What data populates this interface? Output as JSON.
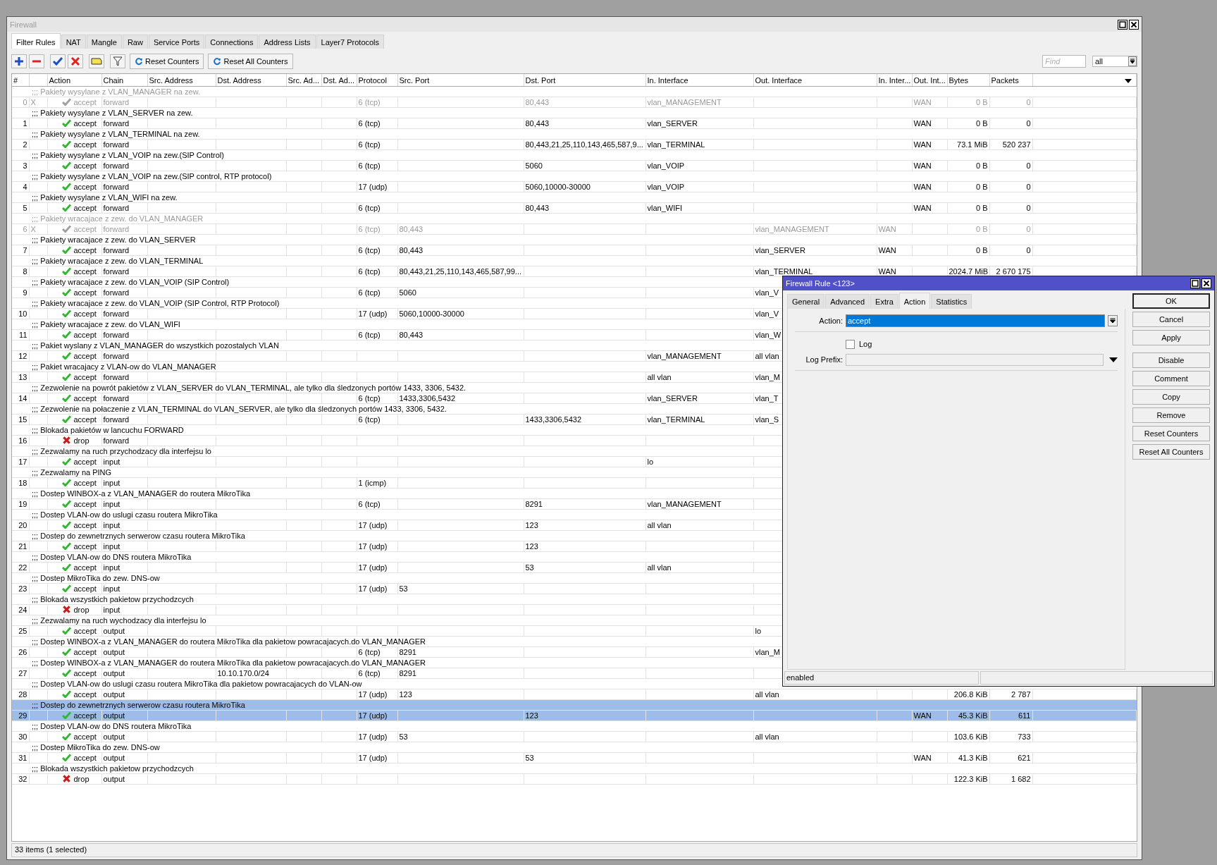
{
  "window": {
    "title": "Firewall"
  },
  "tabs": [
    {
      "label": "Filter Rules",
      "selected": true
    },
    {
      "label": "NAT",
      "selected": false
    },
    {
      "label": "Mangle",
      "selected": false
    },
    {
      "label": "Raw",
      "selected": false
    },
    {
      "label": "Service Ports",
      "selected": false
    },
    {
      "label": "Connections",
      "selected": false
    },
    {
      "label": "Address Lists",
      "selected": false
    },
    {
      "label": "Layer7 Protocols",
      "selected": false
    }
  ],
  "toolbar": {
    "buttons": [
      "Reset Counters",
      "Reset All Counters"
    ],
    "search": {
      "placeholder": "Find"
    },
    "filter": "all"
  },
  "table": {
    "columns": [
      "#",
      "",
      "Action",
      "Chain",
      "Src. Address",
      "Dst. Address",
      "Src. Ad...",
      "Dst. Ad...",
      "Protocol",
      "Src. Port",
      "Dst. Port",
      "In. Interface",
      "Out. Interface",
      "In. Inter...",
      "Out. Int...",
      "Bytes",
      "Packets"
    ],
    "rules": [
      {
        "comment": ";;; Pakiety wysylane z VLAN_MANAGER na zew.",
        "num": "0",
        "flag": "X",
        "kind": "accept",
        "action": "accept",
        "chain": "forward",
        "protocol": "6 (tcp)",
        "dst_port": "80,443",
        "in_interface": "vlan_MANAGEMENT",
        "out_interface_list": "WAN",
        "bytes": "0 B",
        "packets": "0",
        "disabled": true,
        "selected": false
      },
      {
        "comment": ";;; Pakiety wysylane z VLAN_SERVER na zew.",
        "num": "1",
        "kind": "accept",
        "action": "accept",
        "chain": "forward",
        "protocol": "6 (tcp)",
        "dst_port": "80,443",
        "in_interface": "vlan_SERVER",
        "out_interface_list": "WAN",
        "bytes": "0 B",
        "packets": "0",
        "disabled": false,
        "selected": false
      },
      {
        "comment": ";;; Pakiety wysylane z VLAN_TERMINAL na zew.",
        "num": "2",
        "kind": "accept",
        "action": "accept",
        "chain": "forward",
        "protocol": "6 (tcp)",
        "dst_port": "80,443,21,25,110,143,465,587,9...",
        "in_interface": "vlan_TERMINAL",
        "out_interface_list": "WAN",
        "bytes": "73.1 MiB",
        "packets": "520 237",
        "disabled": false,
        "selected": false
      },
      {
        "comment": ";;; Pakiety wysylane z VLAN_VOIP na zew.(SIP Control)",
        "num": "3",
        "kind": "accept",
        "action": "accept",
        "chain": "forward",
        "protocol": "6 (tcp)",
        "dst_port": "5060",
        "in_interface": "vlan_VOIP",
        "out_interface_list": "WAN",
        "bytes": "0 B",
        "packets": "0",
        "disabled": false,
        "selected": false
      },
      {
        "comment": ";;; Pakiety wysylane z VLAN_VOIP na zew.(SIP control, RTP protocol)",
        "num": "4",
        "kind": "accept",
        "action": "accept",
        "chain": "forward",
        "protocol": "17 (udp)",
        "dst_port": "5060,10000-30000",
        "in_interface": "vlan_VOIP",
        "out_interface_list": "WAN",
        "bytes": "0 B",
        "packets": "0",
        "disabled": false,
        "selected": false
      },
      {
        "comment": ";;; Pakiety wysylane z VLAN_WIFI na zew.",
        "num": "5",
        "kind": "accept",
        "action": "accept",
        "chain": "forward",
        "protocol": "6 (tcp)",
        "dst_port": "80,443",
        "in_interface": "vlan_WIFI",
        "out_interface_list": "WAN",
        "bytes": "0 B",
        "packets": "0",
        "disabled": false,
        "selected": false
      },
      {
        "comment": ";;; Pakiety wracajace z zew. do VLAN_MANAGER",
        "num": "6",
        "flag": "X",
        "kind": "accept",
        "action": "accept",
        "chain": "forward",
        "protocol": "6 (tcp)",
        "src_port": "80,443",
        "out_interface": "vlan_MANAGEMENT",
        "in_interface_list": "WAN",
        "bytes": "0 B",
        "packets": "0",
        "disabled": true,
        "selected": false
      },
      {
        "comment": ";;; Pakiety wracajace z zew. do VLAN_SERVER",
        "num": "7",
        "kind": "accept",
        "action": "accept",
        "chain": "forward",
        "protocol": "6 (tcp)",
        "src_port": "80,443",
        "out_interface": "vlan_SERVER",
        "in_interface_list": "WAN",
        "bytes": "0 B",
        "packets": "0",
        "disabled": false,
        "selected": false
      },
      {
        "comment": ";;; Pakiety wracajace z zew. do VLAN_TERMINAL",
        "num": "8",
        "kind": "accept",
        "action": "accept",
        "chain": "forward",
        "protocol": "6 (tcp)",
        "src_port": "80,443,21,25,110,143,465,587,99...",
        "out_interface": "vlan_TERMINAL",
        "in_interface_list": "WAN",
        "bytes": "2024.7 MiB",
        "packets": "2 670 175",
        "disabled": false,
        "selected": false
      },
      {
        "comment": ";;; Pakiety wracajace z zew. do VLAN_VOIP (SIP Control)",
        "num": "9",
        "kind": "accept",
        "action": "accept",
        "chain": "forward",
        "protocol": "6 (tcp)",
        "src_port": "5060",
        "out_interface": "vlan_V",
        "disabled": false,
        "selected": false
      },
      {
        "comment": ";;; Pakiety wracajace z zew. do VLAN_VOIP (SIP Control, RTP Protocol)",
        "num": "10",
        "kind": "accept",
        "action": "accept",
        "chain": "forward",
        "protocol": "17 (udp)",
        "src_port": "5060,10000-30000",
        "out_interface": "vlan_V",
        "disabled": false,
        "selected": false
      },
      {
        "comment": ";;; Pakiety wracajace z zew. do VLAN_WIFI",
        "num": "11",
        "kind": "accept",
        "action": "accept",
        "chain": "forward",
        "protocol": "6 (tcp)",
        "src_port": "80,443",
        "out_interface": "vlan_W",
        "disabled": false,
        "selected": false
      },
      {
        "comment": ";;; Pakiet wyslany z VLAN_MANAGER do wszystkich pozostalych VLAN",
        "num": "12",
        "kind": "accept",
        "action": "accept",
        "chain": "forward",
        "in_interface": "vlan_MANAGEMENT",
        "out_interface": "all vlan",
        "disabled": false,
        "selected": false
      },
      {
        "comment": ";;; Pakiet wracajacy z VLAN-ow do VLAN_MANAGER",
        "num": "13",
        "kind": "accept",
        "action": "accept",
        "chain": "forward",
        "in_interface": "all vlan",
        "out_interface": "vlan_M",
        "disabled": false,
        "selected": false
      },
      {
        "comment": ";;; Zezwolenie na powrót pakietów z VLAN_SERVER do VLAN_TERMINAL, ale tylko dla śledzonych portów 1433, 3306, 5432.",
        "num": "14",
        "kind": "accept",
        "action": "accept",
        "chain": "forward",
        "protocol": "6 (tcp)",
        "src_port": "1433,3306,5432",
        "in_interface": "vlan_SERVER",
        "out_interface": "vlan_T",
        "disabled": false,
        "selected": false
      },
      {
        "comment": ";;; Zezwolenie na połaczenie z VLAN_TERMINAL do VLAN_SERVER, ale tylko dla śledzonych portów 1433, 3306, 5432.",
        "num": "15",
        "kind": "accept",
        "action": "accept",
        "chain": "forward",
        "protocol": "6 (tcp)",
        "dst_port": "1433,3306,5432",
        "in_interface": "vlan_TERMINAL",
        "out_interface": "vlan_S",
        "disabled": false,
        "selected": false
      },
      {
        "comment": ";;; Blokada pakietów w lancuchu FORWARD",
        "num": "16",
        "kind": "drop",
        "action": "drop",
        "chain": "forward",
        "disabled": false,
        "selected": false
      },
      {
        "comment": ";;; Zezwalamy na ruch przychodzacy dla interfejsu lo",
        "num": "17",
        "kind": "accept",
        "action": "accept",
        "chain": "input",
        "in_interface": "lo",
        "disabled": false,
        "selected": false
      },
      {
        "comment": ";;; Zezwalamy na PING",
        "num": "18",
        "kind": "accept",
        "action": "accept",
        "chain": "input",
        "protocol": "1 (icmp)",
        "disabled": false,
        "selected": false
      },
      {
        "comment": ";;; Dostep WINBOX-a z VLAN_MANAGER do routera MikroTika",
        "num": "19",
        "kind": "accept",
        "action": "accept",
        "chain": "input",
        "protocol": "6 (tcp)",
        "dst_port": "8291",
        "in_interface": "vlan_MANAGEMENT",
        "disabled": false,
        "selected": false
      },
      {
        "comment": ";;; Dostep VLAN-ow do uslugi czasu routera MikroTika",
        "num": "20",
        "kind": "accept",
        "action": "accept",
        "chain": "input",
        "protocol": "17 (udp)",
        "dst_port": "123",
        "in_interface": "all vlan",
        "disabled": false,
        "selected": false
      },
      {
        "comment": ";;; Dostep do zewnetrznych serwerow czasu routera MikroTika",
        "num": "21",
        "kind": "accept",
        "action": "accept",
        "chain": "input",
        "protocol": "17 (udp)",
        "dst_port": "123",
        "disabled": false,
        "selected": false
      },
      {
        "comment": ";;; Dostep VLAN-ow do DNS routera MikroTika",
        "num": "22",
        "kind": "accept",
        "action": "accept",
        "chain": "input",
        "protocol": "17 (udp)",
        "dst_port": "53",
        "in_interface": "all vlan",
        "disabled": false,
        "selected": false
      },
      {
        "comment": ";;; Dostep MikroTika do zew. DNS-ow",
        "num": "23",
        "kind": "accept",
        "action": "accept",
        "chain": "input",
        "protocol": "17 (udp)",
        "src_port": "53",
        "disabled": false,
        "selected": false
      },
      {
        "comment": ";;; Blokada wszystkich pakietow przychodzcych",
        "num": "24",
        "kind": "drop",
        "action": "drop",
        "chain": "input",
        "disabled": false,
        "selected": false
      },
      {
        "comment": ";;; Zezwalamy na ruch wychodzacy dla interfejsu lo",
        "num": "25",
        "kind": "accept",
        "action": "accept",
        "chain": "output",
        "out_interface": "lo",
        "disabled": false,
        "selected": false
      },
      {
        "comment": ";;; Dostep WINBOX-a z VLAN_MANAGER do routera MikroTika dla pakietow powracajacych.do VLAN_MANAGER",
        "num": "26",
        "kind": "accept",
        "action": "accept",
        "chain": "output",
        "protocol": "6 (tcp)",
        "src_port": "8291",
        "out_interface": "vlan_M",
        "disabled": false,
        "selected": false
      },
      {
        "comment": ";;; Dostep WINBOX-a z VLAN_MANAGER do routera MikroTika dla pakietow powracajacych.do VLAN_MANAGER",
        "num": "27",
        "kind": "accept",
        "action": "accept",
        "chain": "output",
        "dst_address": "10.10.170.0/24",
        "protocol": "6 (tcp)",
        "src_port": "8291",
        "disabled": false,
        "selected": false
      },
      {
        "comment": ";;; Dostep VLAN-ow do uslugi czasu routera MikroTika dla pakietow powracajacych do VLAN-ow",
        "num": "28",
        "kind": "accept",
        "action": "accept",
        "chain": "output",
        "protocol": "17 (udp)",
        "src_port": "123",
        "out_interface": "all vlan",
        "bytes": "206.8 KiB",
        "packets": "2 787",
        "disabled": false,
        "selected": false
      },
      {
        "comment": ";;; Dostep do zewnetrznych serwerow czasu routera MikroTika",
        "num": "29",
        "kind": "accept",
        "action": "accept",
        "chain": "output",
        "protocol": "17 (udp)",
        "dst_port": "123",
        "out_interface_list": "WAN",
        "bytes": "45.3 KiB",
        "packets": "611",
        "disabled": false,
        "selected": true
      },
      {
        "comment": ";;; Dostep VLAN-ow do DNS routera MikroTika",
        "num": "30",
        "kind": "accept",
        "action": "accept",
        "chain": "output",
        "protocol": "17 (udp)",
        "src_port": "53",
        "out_interface": "all vlan",
        "bytes": "103.6 KiB",
        "packets": "733",
        "disabled": false,
        "selected": false
      },
      {
        "comment": ";;; Dostep MikroTika do zew. DNS-ow",
        "num": "31",
        "kind": "accept",
        "action": "accept",
        "chain": "output",
        "protocol": "17 (udp)",
        "dst_port": "53",
        "out_interface_list": "WAN",
        "bytes": "41.3 KiB",
        "packets": "621",
        "disabled": false,
        "selected": false
      },
      {
        "comment": ";;; Blokada wszystkich pakietow przychodzcych",
        "num": "32",
        "kind": "drop",
        "action": "drop",
        "chain": "output",
        "bytes": "122.3 KiB",
        "packets": "1 682",
        "disabled": false,
        "selected": false
      }
    ]
  },
  "status_bar": "33 items (1 selected)",
  "dialog": {
    "title": "Firewall Rule <123>",
    "tabs": [
      {
        "label": "General",
        "selected": false
      },
      {
        "label": "Advanced",
        "selected": false
      },
      {
        "label": "Extra",
        "selected": false
      },
      {
        "label": "Action",
        "selected": true
      },
      {
        "label": "Statistics",
        "selected": false
      }
    ],
    "action_label": "Action:",
    "action_value": "accept",
    "log": {
      "label": "Log",
      "checked": false
    },
    "log_prefix_label": "Log Prefix:",
    "buttons": [
      {
        "label": "OK",
        "default": true
      },
      {
        "label": "Cancel",
        "default": false
      },
      {
        "label": "Apply",
        "default": false
      },
      {
        "label": "Disable",
        "default": false
      },
      {
        "label": "Comment",
        "default": false
      },
      {
        "label": "Copy",
        "default": false
      },
      {
        "label": "Remove",
        "default": false
      },
      {
        "label": "Reset Counters",
        "default": false
      },
      {
        "label": "Reset All Counters",
        "default": false
      }
    ],
    "status": "enabled"
  }
}
